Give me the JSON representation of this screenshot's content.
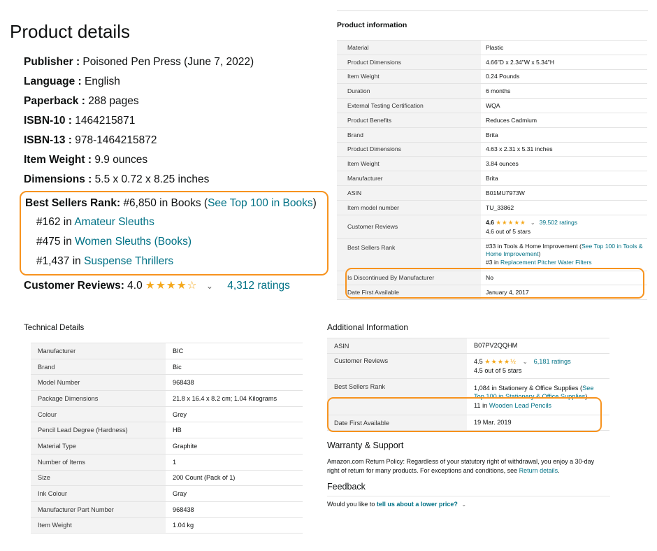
{
  "product_details": {
    "title": "Product details",
    "rows": [
      {
        "key": "Publisher",
        "value": "Poisoned Pen Press (June 7, 2022)"
      },
      {
        "key": "Language",
        "value": "English"
      },
      {
        "key": "Paperback",
        "value": "288 pages"
      },
      {
        "key": "ISBN-10",
        "value": "1464215871"
      },
      {
        "key": "ISBN-13",
        "value": "978-1464215872"
      },
      {
        "key": "Item Weight",
        "value": "9.9 ounces"
      },
      {
        "key": "Dimensions",
        "value": "5.5 x 0.72 x 8.25 inches"
      }
    ],
    "best_sellers": {
      "label": "Best Sellers Rank:",
      "main": "#6,850 in Books (",
      "see_top": "See Top 100 in Books",
      "close": ")",
      "subs": [
        {
          "rank": "#162 in",
          "category": "Amateur Sleuths"
        },
        {
          "rank": "#475 in",
          "category": "Women Sleuths (Books)"
        },
        {
          "rank": "#1,437 in",
          "category": "Suspense Thrillers"
        }
      ]
    },
    "reviews": {
      "label": "Customer Reviews:",
      "score": "4.0",
      "stars": "★★★★☆",
      "chevron": "⌄",
      "ratings": "4,312 ratings"
    }
  },
  "product_information": {
    "title": "Product information",
    "rows": [
      {
        "key": "Material",
        "value": "Plastic"
      },
      {
        "key": "Product Dimensions",
        "value": "4.66\"D x 2.34\"W x 5.34\"H"
      },
      {
        "key": "Item Weight",
        "value": "0.24 Pounds"
      },
      {
        "key": "Duration",
        "value": "6 months"
      },
      {
        "key": "External Testing Certification",
        "value": "WQA"
      },
      {
        "key": "Product Benefits",
        "value": "Reduces Cadmium"
      },
      {
        "key": "Brand",
        "value": "Brita"
      },
      {
        "key": "Product Dimensions",
        "value": "4.63 x 2.31 x 5.31 inches"
      },
      {
        "key": "Item Weight",
        "value": "3.84 ounces"
      },
      {
        "key": "Manufacturer",
        "value": "Brita"
      },
      {
        "key": "ASIN",
        "value": "B01MU7973W"
      },
      {
        "key": "Item model number",
        "value": "TU_33862"
      }
    ],
    "reviews": {
      "key": "Customer Reviews",
      "score": "4.6",
      "stars": "★★★★★",
      "chevron": "⌄",
      "ratings": "39,502 ratings",
      "out_of": "4.6 out of 5 stars"
    },
    "best_sellers": {
      "key": "Best Sellers Rank",
      "main": "#33 in Tools & Home Improvement (",
      "see_top": "See Top 100 in Tools & Home Improvement",
      "close": ")",
      "sub_rank": "#3 in",
      "sub_category": "Replacement Pitcher Water Filters"
    },
    "tail_rows": [
      {
        "key": "Is Discontinued By Manufacturer",
        "value": "No"
      },
      {
        "key": "Date First Available",
        "value": "January 4, 2017"
      }
    ]
  },
  "technical_details": {
    "title": "Technical Details",
    "rows": [
      {
        "key": "Manufacturer",
        "value": "BIC"
      },
      {
        "key": "Brand",
        "value": "Bic"
      },
      {
        "key": "Model Number",
        "value": "968438"
      },
      {
        "key": "Package Dimensions",
        "value": "21.8 x 16.4 x 8.2 cm; 1.04 Kilograms"
      },
      {
        "key": "Colour",
        "value": "Grey"
      },
      {
        "key": "Pencil Lead Degree (Hardness)",
        "value": "HB"
      },
      {
        "key": "Material Type",
        "value": "Graphite"
      },
      {
        "key": "Number of Items",
        "value": "1"
      },
      {
        "key": "Size",
        "value": "200 Count (Pack of 1)"
      },
      {
        "key": "Ink Colour",
        "value": "Gray"
      },
      {
        "key": "Manufacturer Part Number",
        "value": "968438"
      },
      {
        "key": "Item Weight",
        "value": "1.04 kg"
      }
    ]
  },
  "additional_information": {
    "title": "Additional Information",
    "asin": {
      "key": "ASIN",
      "value": "B07PV2QQHM"
    },
    "reviews": {
      "key": "Customer Reviews",
      "score": "4.5",
      "stars": "★★★★½",
      "chevron": "⌄",
      "ratings": "6,181 ratings",
      "out_of": "4.5 out of 5 stars"
    },
    "best_sellers": {
      "key": "Best Sellers Rank",
      "main": "1,084 in Stationery & Office Supplies (",
      "see_top": "See Top 100 in Stationery & Office Supplies",
      "close": ")",
      "sub_rank": "11 in",
      "sub_category": "Wooden Lead Pencils"
    },
    "date": {
      "key": "Date First Available",
      "value": "19 Mar. 2019"
    },
    "warranty_title": "Warranty & Support",
    "policy_text": "Amazon.com Return Policy: Regardless of your statutory right of withdrawal, you enjoy a 30-day right of return for many products. For exceptions and conditions, see ",
    "policy_link": "Return details",
    "policy_end": ".",
    "feedback_title": "Feedback",
    "feedback_text": "Would you like to ",
    "feedback_link": "tell us about a lower price?",
    "feedback_chevron": "⌄"
  },
  "colors": {
    "link": "#007185",
    "highlight": "#f7931e",
    "star": "#f4a81c",
    "label_bg": "#f3f3f3"
  }
}
